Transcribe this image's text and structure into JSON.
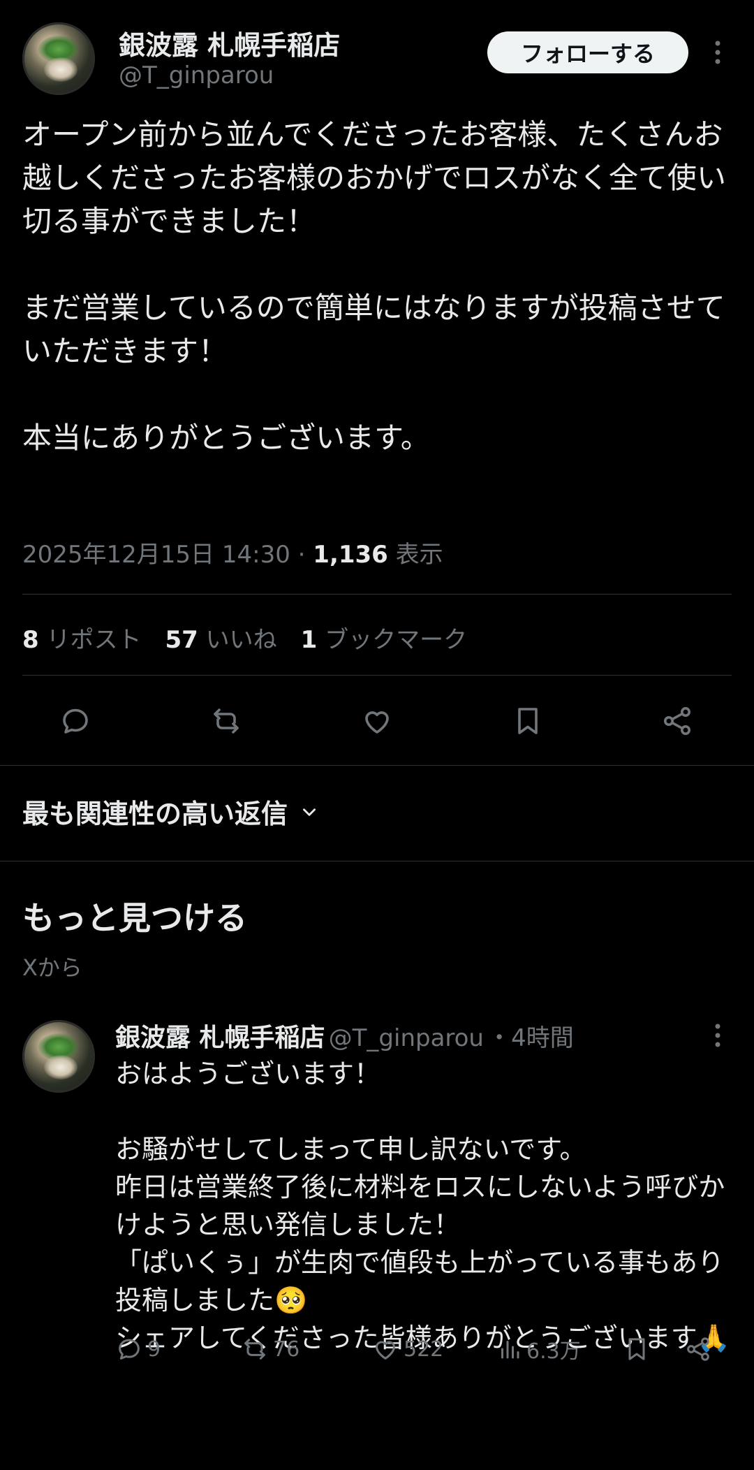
{
  "tweet": {
    "author_name": "銀波露 札幌手稲店",
    "author_handle": "@T_ginparou",
    "follow_label": "フォローする",
    "text": "オープン前から並んでくださったお客様、たくさんお越しくださったお客様のおかげでロスがなく全て使い切る事ができました！\n\nまだ営業しているので簡単にはなりますが投稿させていただきます！\n\n本当にありがとうございます。",
    "timestamp": "2025年12月15日 14:30",
    "views_count": "1,136",
    "views_label": "表示",
    "reposts_count": "8",
    "reposts_label": "リポスト",
    "likes_count": "57",
    "likes_label": "いいね",
    "bookmarks_count": "1",
    "bookmarks_label": "ブックマーク"
  },
  "actions": [
    "reply-icon",
    "repost-icon",
    "like-icon",
    "bookmark-icon",
    "share-icon"
  ],
  "replies_sort_label": "最も関連性の高い返信",
  "discover": {
    "title": "もっと見つける",
    "subtitle": "Xから"
  },
  "reply": {
    "author_name": "銀波露 札幌手稲店",
    "author_handle": "@T_ginparou",
    "time": "・4時間",
    "text": "おはようございます！\n\nお騒がせしてしまって申し訳ないです。\n昨日は営業終了後に材料をロスにしないよう呼びかけようと思い発信しました！\n「ぱいくぅ」が生肉で値段も上がっている事もあり投稿しました🥺\nシェアしてくださった皆様ありがとうございます🙏",
    "replies": "9",
    "reposts": "76",
    "likes": "522",
    "views": "6.3万"
  },
  "colors": {
    "background": "#000000",
    "text": "#e7e9ea",
    "muted": "#71767b",
    "divider": "#2f3336",
    "button_bg": "#eff3f4"
  }
}
